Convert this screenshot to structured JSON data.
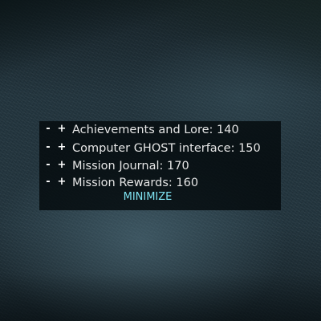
{
  "hud_list": {
    "items": [
      {
        "minus_label": "-",
        "plus_label": "+",
        "label": "Achievements and Lore: 140"
      },
      {
        "minus_label": "-",
        "plus_label": "+",
        "label": "Computer GHOST interface: 150"
      },
      {
        "minus_label": "-",
        "plus_label": "+",
        "label": "Mission Journal: 170"
      },
      {
        "minus_label": "-",
        "plus_label": "+",
        "label": "Mission Rewards: 160"
      }
    ],
    "minimize_label": "MINIMIZE"
  },
  "colors": {
    "panel_background": "#040a0c",
    "item_text": "#e6e6e6",
    "control_text": "#ffffff",
    "minimize_text": "#7fe3f2",
    "ground": "#22343d"
  }
}
